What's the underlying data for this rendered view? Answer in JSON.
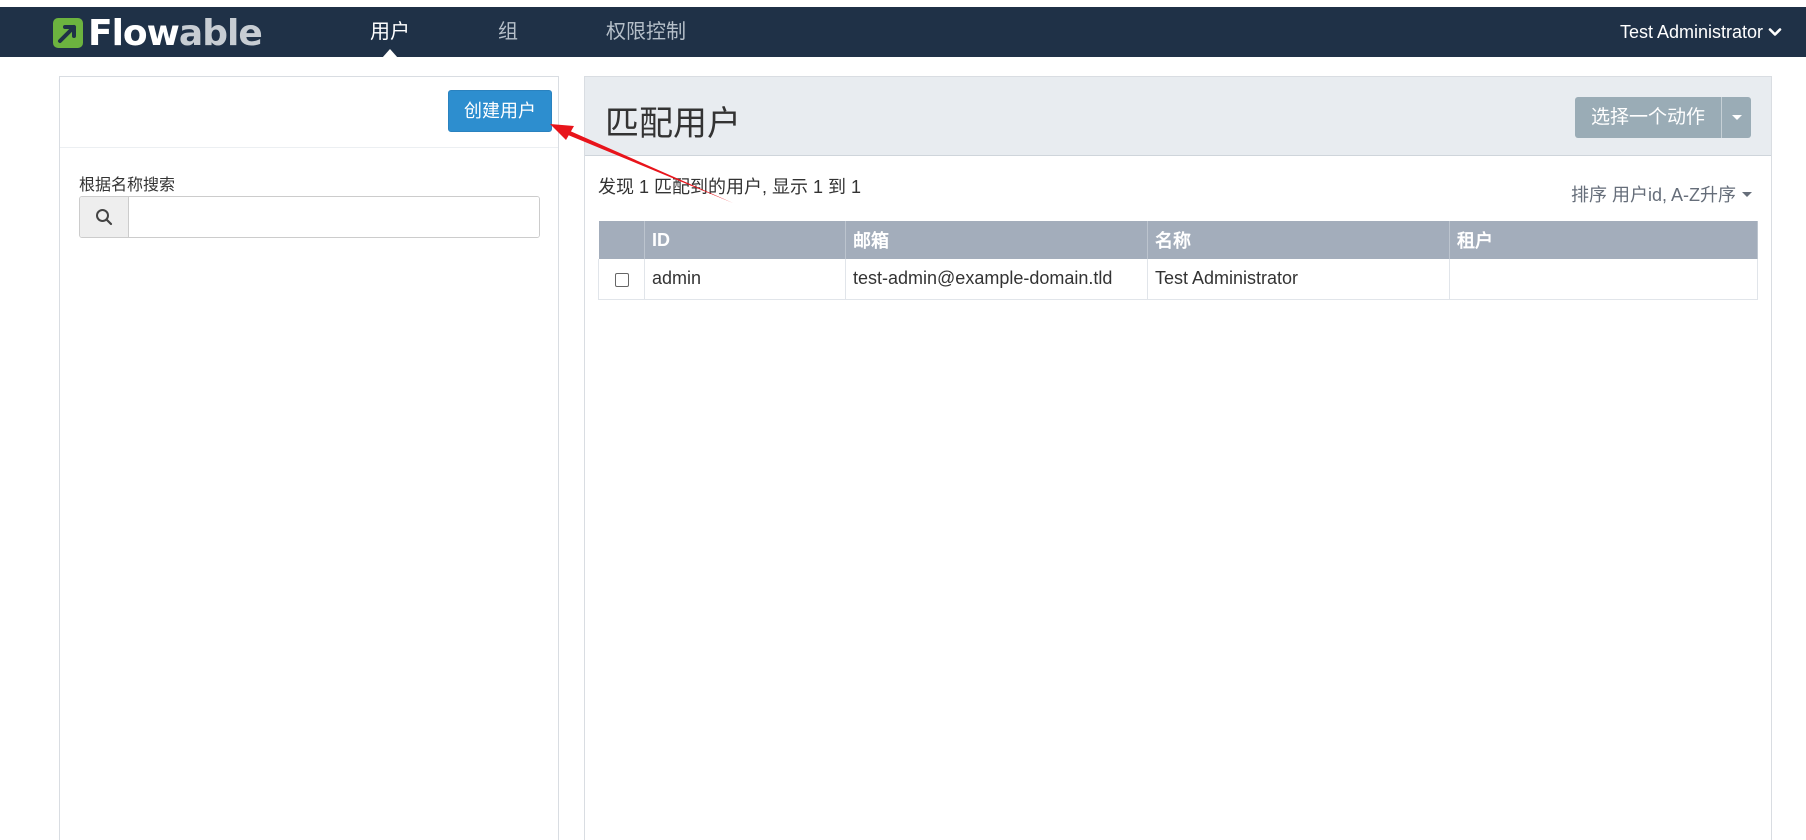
{
  "brand": {
    "logo_main": "Flow",
    "logo_accent": "able"
  },
  "nav": {
    "items": [
      {
        "label": "用户",
        "active": true
      },
      {
        "label": "组",
        "active": false
      },
      {
        "label": "权限控制",
        "active": false
      }
    ],
    "user_name": "Test Administrator"
  },
  "left": {
    "create_button": "创建用户",
    "search_label": "根据名称搜索",
    "search_value": "",
    "search_placeholder": ""
  },
  "right": {
    "title": "匹配用户",
    "action_button": "选择一个动作",
    "result_info": "发现 1 匹配到的用户, 显示 1 到 1",
    "sort_label": "排序 用户id, A-Z升序",
    "columns": [
      "ID",
      "邮箱",
      "名称",
      "租户"
    ],
    "rows": [
      {
        "id": "admin",
        "email": "test-admin@example-domain.tld",
        "name": "Test Administrator",
        "tenant": ""
      }
    ]
  },
  "colors": {
    "topbar": "#1f3147",
    "primary_button": "#2d8ecf",
    "action_button": "#9aacb6",
    "table_header": "#a3adbb",
    "annotation_arrow": "#e8141b"
  }
}
